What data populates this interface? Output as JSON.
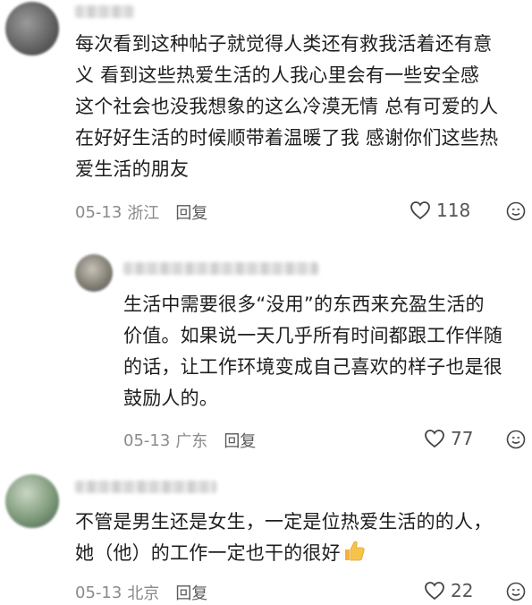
{
  "comments": [
    {
      "text": "每次看到这种帖子就觉得人类还有救我活着还有意\n义 看到这些热爱生活的人我心里会有一些安全感\n这个社会也没我想象的这么冷漠无情 总有可爱的人\n在好好生活的时候顺带着温暖了我 感谢你们这些热\n爱生活的朋友",
      "date": "05-13",
      "location": "浙江",
      "reply_label": "回复",
      "likes": "118"
    },
    {
      "text": "生活中需要很多“没用”的东西来充盈生活的\n价值。如果说一天几乎所有时间都跟工作伴随\n的话，让工作环境变成自己喜欢的样子也是很\n鼓励人的。",
      "date": "05-13",
      "location": "广东",
      "reply_label": "回复",
      "likes": "77"
    },
    {
      "text": "不管是男生还是女生，一定是位热爱生活的的人，\n她（他）的工作一定也干的很好",
      "date": "05-13",
      "location": "北京",
      "reply_label": "回复",
      "likes": "22"
    }
  ],
  "icons": {
    "like": "heart-outline-icon",
    "react": "smiley-icon",
    "thumbs_up": "thumbs-up-emoji"
  }
}
